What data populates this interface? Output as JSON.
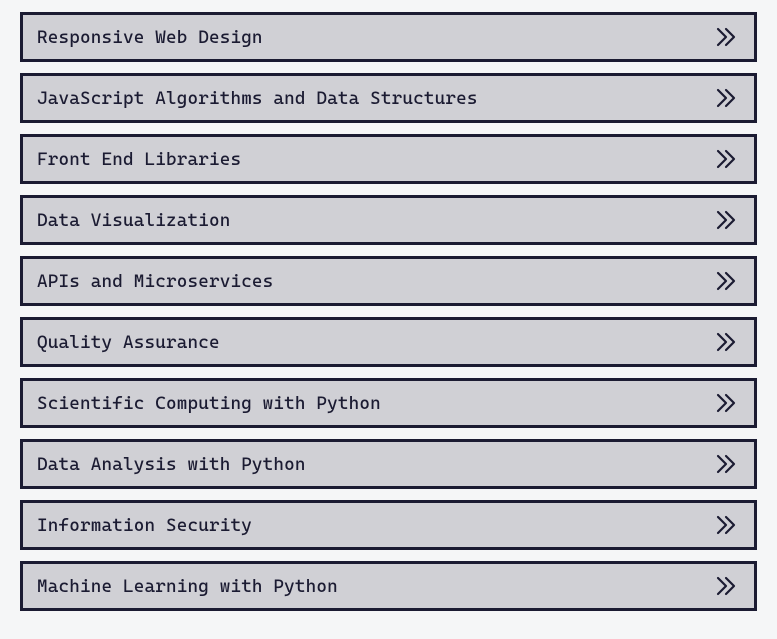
{
  "courses": [
    {
      "label": "Responsive Web Design"
    },
    {
      "label": "JavaScript Algorithms and Data Structures"
    },
    {
      "label": "Front End Libraries"
    },
    {
      "label": "Data Visualization"
    },
    {
      "label": "APIs and Microservices"
    },
    {
      "label": "Quality Assurance"
    },
    {
      "label": "Scientific Computing with Python"
    },
    {
      "label": "Data Analysis with Python"
    },
    {
      "label": "Information Security"
    },
    {
      "label": "Machine Learning with Python"
    }
  ]
}
